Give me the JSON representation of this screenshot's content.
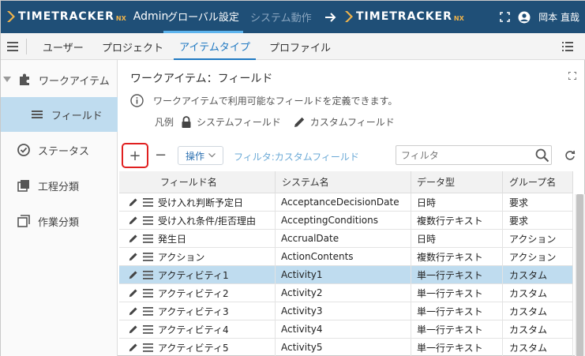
{
  "header": {
    "logo_text": "TIMETRACKER",
    "logo_suffix": "NX",
    "admin_label": "Admin",
    "nav": [
      {
        "label": "グローバル設定",
        "active": true
      },
      {
        "label": "システム動作",
        "active": false
      }
    ],
    "user_name": "岡本 直哉"
  },
  "subnav": {
    "tabs": [
      {
        "label": "ユーザー",
        "active": false
      },
      {
        "label": "プロジェクト",
        "active": false
      },
      {
        "label": "アイテムタイプ",
        "active": true
      },
      {
        "label": "プロファイル",
        "active": false
      }
    ]
  },
  "sidebar": {
    "items": [
      {
        "label": "ワークアイテム",
        "icon": "puzzle-icon",
        "selected": false
      },
      {
        "label": "フィールド",
        "icon": "list-icon",
        "selected": true
      },
      {
        "label": "ステータス",
        "icon": "check-circle-icon",
        "selected": false
      },
      {
        "label": "工程分類",
        "icon": "layers-icon",
        "selected": false
      },
      {
        "label": "作業分類",
        "icon": "squares-icon",
        "selected": false
      }
    ]
  },
  "main": {
    "title": "ワークアイテム：フィールド",
    "info": "ワークアイテムで利用可能なフィールドを定義できます。",
    "legend_label": "凡例",
    "legend_system": "システムフィールド",
    "legend_custom": "カスタムフィールド"
  },
  "toolbar": {
    "add_label": "+",
    "remove_label": "−",
    "operation_label": "操作",
    "filter_link": "フィルタ:カスタムフィールド",
    "filter_placeholder": "フィルタ"
  },
  "table": {
    "columns": [
      "フィールド名",
      "システム名",
      "データ型",
      "グループ名"
    ],
    "rows": [
      {
        "name": "受け入れ判断予定日",
        "system": "AcceptanceDecisionDate",
        "type": "日時",
        "group": "要求",
        "selected": false
      },
      {
        "name": "受け入れ条件/拒否理由",
        "system": "AcceptingConditions",
        "type": "複数行テキスト",
        "group": "要求",
        "selected": false
      },
      {
        "name": "発生日",
        "system": "AccrualDate",
        "type": "日時",
        "group": "アクション",
        "selected": false
      },
      {
        "name": "アクション",
        "system": "ActionContents",
        "type": "複数行テキスト",
        "group": "アクション",
        "selected": false
      },
      {
        "name": "アクティビティ1",
        "system": "Activity1",
        "type": "単一行テキスト",
        "group": "カスタム",
        "selected": true
      },
      {
        "name": "アクティビティ2",
        "system": "Activity2",
        "type": "単一行テキスト",
        "group": "カスタム",
        "selected": false
      },
      {
        "name": "アクティビティ3",
        "system": "Activity3",
        "type": "単一行テキスト",
        "group": "カスタム",
        "selected": false
      },
      {
        "name": "アクティビティ4",
        "system": "Activity4",
        "type": "単一行テキスト",
        "group": "カスタム",
        "selected": false
      },
      {
        "name": "アクティビティ5",
        "system": "Activity5",
        "type": "単一行テキスト",
        "group": "カスタム",
        "selected": false
      }
    ]
  },
  "colors": {
    "header_bg": "#1f4f77",
    "accent": "#1e78c2",
    "selected_bg": "#bfdcef",
    "highlight_border": "#e02020"
  }
}
